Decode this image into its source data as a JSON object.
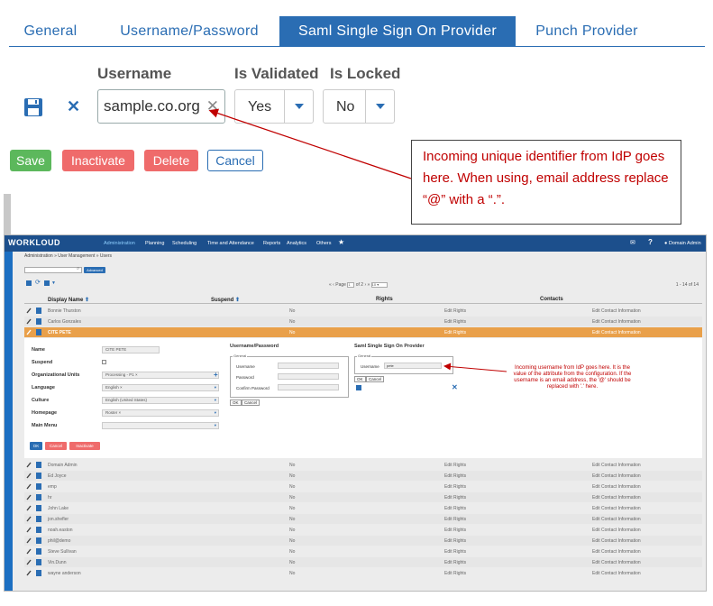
{
  "tabs": [
    "General",
    "Username/Password",
    "Saml Single Sign On Provider",
    "Punch Provider"
  ],
  "form": {
    "username_label": "Username",
    "is_validated_label": "Is Validated",
    "is_locked_label": "Is Locked",
    "username_value": "sample.co.org",
    "validated_value": "Yes",
    "locked_value": "No"
  },
  "buttons": {
    "save": "Save",
    "inactivate": "Inactivate",
    "delete": "Delete",
    "cancel": "Cancel"
  },
  "callout_top": "Incoming unique identifier from IdP goes here.  When using, email address replace “@” with a “.”.",
  "app": {
    "logo": "WORKLOUD",
    "nav": [
      "Administration",
      "Planning",
      "Scheduling",
      "Time and Attendance",
      "Reports",
      "Analytics",
      "Others"
    ],
    "user": "Domain Admin",
    "breadcrumb": "Administration » User Management » Users",
    "advanced": "Advanced",
    "pager_page": "Page",
    "pager_of": "of 2",
    "pager_page_value": "1",
    "pager_size": "10",
    "count": "1 - 14 of 14",
    "columns": [
      "Display Name",
      "Suspend",
      "Rights",
      "Contacts"
    ],
    "rows_top": [
      {
        "name": "Bonnie Thurston",
        "suspend": "No",
        "rights": "Edit Rights",
        "contacts": "Edit Contact Information"
      },
      {
        "name": "Carlos Gonzales",
        "suspend": "No",
        "rights": "Edit Rights",
        "contacts": "Edit Contact Information"
      },
      {
        "name": "CITE PETE",
        "suspend": "No",
        "rights": "Edit Rights",
        "contacts": "Edit Contact Information"
      }
    ],
    "detail": {
      "name_label": "Name",
      "name_value": "CITE PETE",
      "suspend_label": "Suspend",
      "org_label": "Organizational Units",
      "org_value": "Processing - P1",
      "lang_label": "Language",
      "lang_value": "English",
      "culture_label": "Culture",
      "culture_value": "English (United States)",
      "home_label": "Homepage",
      "home_value": "Roster",
      "menu_label": "Main Menu",
      "up_title": "Username/Password",
      "general_legend": "General",
      "up_username": "Username",
      "up_password": "Password",
      "up_confirm": "Confirm Password",
      "ok": "OK",
      "cancel": "Cancel",
      "saml_title": "Saml Single Sign On Provider",
      "saml_username": "Username",
      "saml_value": "pete",
      "ok_btn": "OK",
      "cancel_btn": "Cancel",
      "inactivate_btn": "Inactivate"
    },
    "rows_bottom": [
      {
        "name": "Domain Admin",
        "suspend": "No",
        "rights": "Edit Rights",
        "contacts": "Edit Contact Information"
      },
      {
        "name": "Ed Joyce",
        "suspend": "No",
        "rights": "Edit Rights",
        "contacts": "Edit Contact Information"
      },
      {
        "name": "emp",
        "suspend": "No",
        "rights": "Edit Rights",
        "contacts": "Edit Contact Information"
      },
      {
        "name": "hr",
        "suspend": "No",
        "rights": "Edit Rights",
        "contacts": "Edit Contact Information"
      },
      {
        "name": "John Lake",
        "suspend": "No",
        "rights": "Edit Rights",
        "contacts": "Edit Contact Information"
      },
      {
        "name": "jon.shefler",
        "suspend": "No",
        "rights": "Edit Rights",
        "contacts": "Edit Contact Information"
      },
      {
        "name": "noah.easton",
        "suspend": "No",
        "rights": "Edit Rights",
        "contacts": "Edit Contact Information"
      },
      {
        "name": "phil@demo",
        "suspend": "No",
        "rights": "Edit Rights",
        "contacts": "Edit Contact Information"
      },
      {
        "name": "Steve Sullivan",
        "suspend": "No",
        "rights": "Edit Rights",
        "contacts": "Edit Contact Information"
      },
      {
        "name": "Vin.Dunn",
        "suspend": "No",
        "rights": "Edit Rights",
        "contacts": "Edit Contact Information"
      },
      {
        "name": "wayne anderson",
        "suspend": "No",
        "rights": "Edit Rights",
        "contacts": "Edit Contact Information"
      }
    ]
  },
  "callout_bottom": "Incoming username from IdP goes here. It is the value of the attribute from the configuration.  If the username is an email address, the '@' should be replaced with '.' here.",
  "colors": {
    "accent": "#2a6db3",
    "save": "#5cb85c",
    "danger": "#ef6b6b",
    "callout": "#c00000",
    "selected_row": "#e9a04a",
    "nav": "#1c4f8c"
  }
}
